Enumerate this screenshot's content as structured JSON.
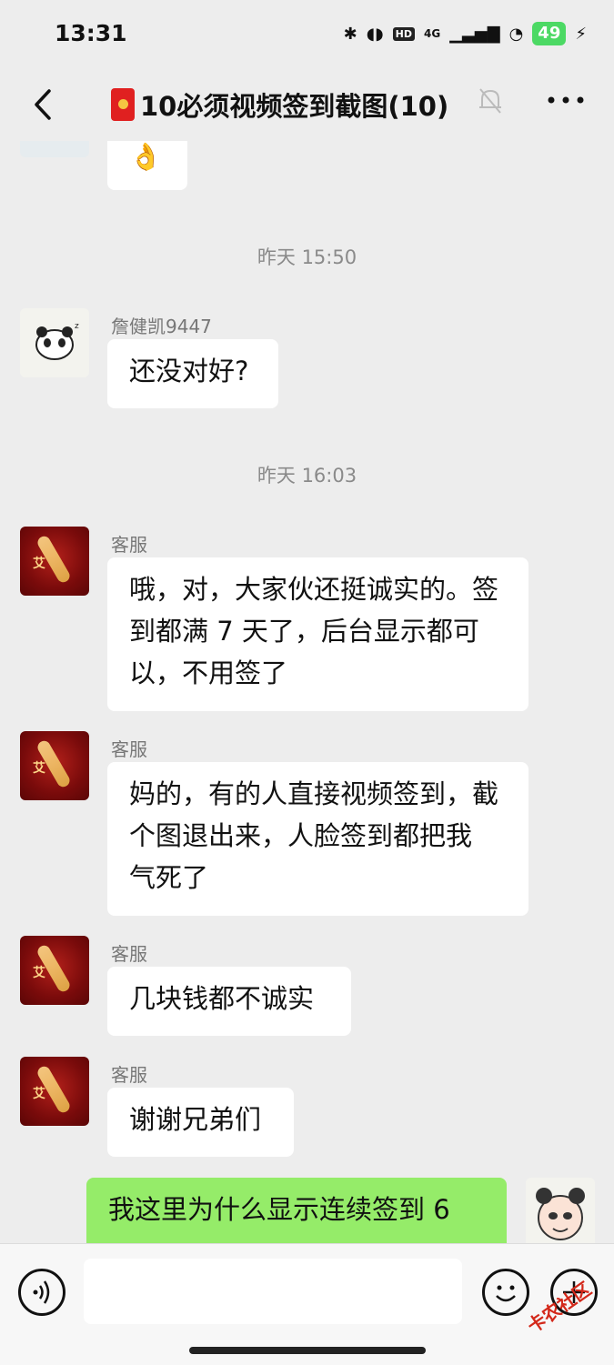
{
  "status_bar": {
    "time": "13:31",
    "network": "4G",
    "hd_label": "HD",
    "battery": "49"
  },
  "nav": {
    "title": "10必须视频签到截图(10)",
    "back_icon": "chevron-left-icon",
    "mute_icon": "bell-off-icon",
    "more_icon": "more-icon"
  },
  "messages": {
    "partial": {
      "text": "👌"
    },
    "ts1": "昨天 15:50",
    "m1": {
      "sender": "詹健凯9447",
      "text": "还没对好?"
    },
    "ts2": "昨天 16:03",
    "m2": {
      "sender": "客服",
      "line1": "哦，对，大家伙还挺诚实的。签",
      "line2": "到都满 7 天了，后台显示都可",
      "line3": "以，不用签了"
    },
    "m3": {
      "sender": "客服",
      "line1": "妈的，有的人直接视频签到，截",
      "line2": "个图退出来，人脸签到都把我",
      "line3": "气死了"
    },
    "m4": {
      "sender": "客服",
      "text": "几块钱都不诚实"
    },
    "m5": {
      "sender": "客服",
      "text": "谢谢兄弟们"
    },
    "mine": {
      "text": "我这里为什么显示连续签到 6"
    }
  },
  "watermark": "卡农社区",
  "colors": {
    "background": "#ededed",
    "self_bubble": "#95ec69",
    "other_bubble": "#ffffff",
    "timestamp": "#8a8a8a"
  }
}
